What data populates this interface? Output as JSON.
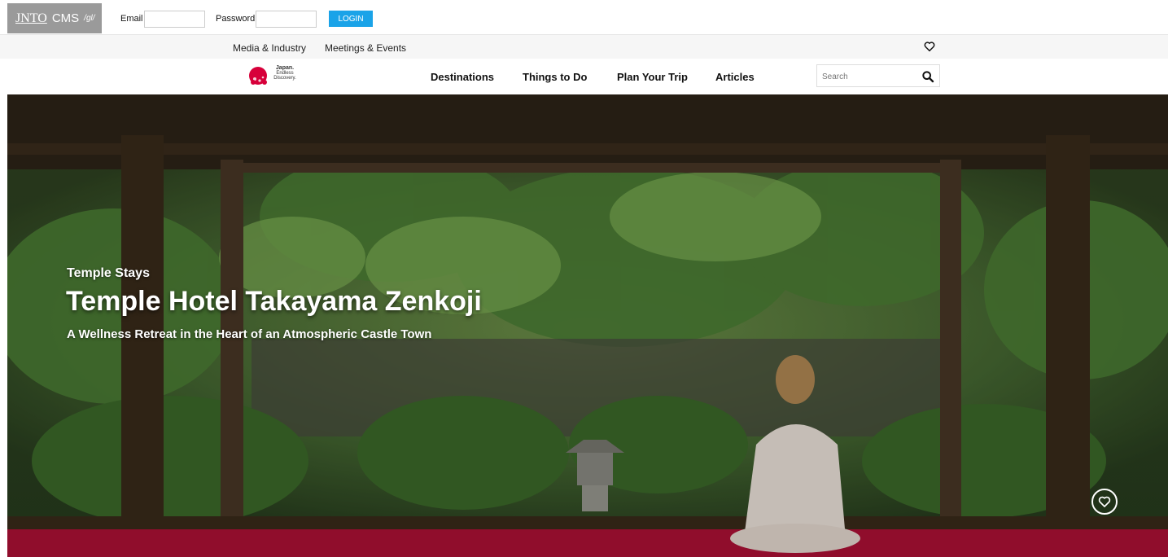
{
  "cms": {
    "logo_brand": "JNTO",
    "logo_cms": "CMS",
    "logo_suffix": "/gl/",
    "email_label": "Email",
    "email_value": "",
    "password_label": "Password",
    "password_value": "",
    "login_label": "LOGIN"
  },
  "sub_nav": {
    "links": [
      "Media & Industry",
      "Meetings & Events"
    ],
    "favorites_icon": "heart-outline-icon"
  },
  "main_nav": {
    "brand_line1": "Japan.",
    "brand_line2": "Endless",
    "brand_line3": "Discovery.",
    "links": [
      "Destinations",
      "Things to Do",
      "Plan Your Trip",
      "Articles"
    ],
    "search_placeholder": "Search",
    "search_icon": "magnifier-icon"
  },
  "hero": {
    "category": "Temple Stays",
    "title": "Temple Hotel Takayama Zenkoji",
    "subtitle": "A Wellness Retreat in the Heart of an Atmospheric Castle Town",
    "favorite_icon": "heart-circle-icon"
  },
  "colors": {
    "login_button": "#1aa3e8",
    "cms_logo_bg": "#9a9a9a",
    "brand_red": "#d7003a",
    "carpet": "#b01036"
  }
}
